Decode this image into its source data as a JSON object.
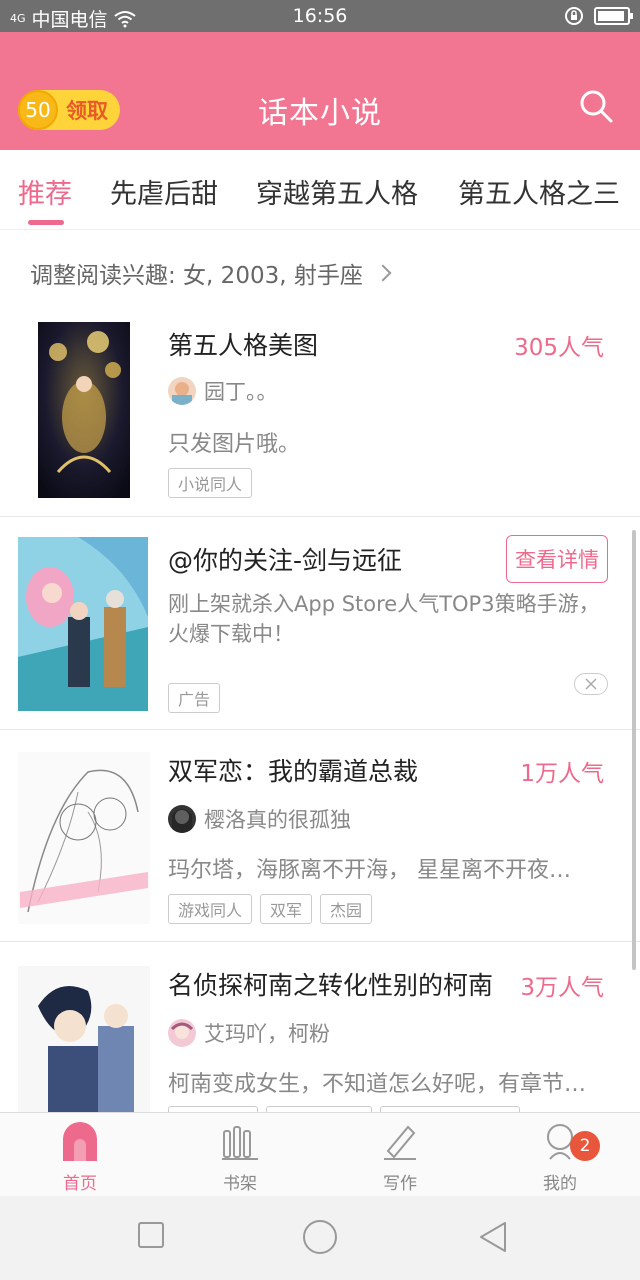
{
  "status_bar": {
    "signal": "4G",
    "carrier": "中国电信",
    "time": "16:56"
  },
  "header": {
    "coin_value": "50",
    "coin_label": "领取",
    "title": "话本小说",
    "accent": "#f27592"
  },
  "tabs": [
    {
      "label": "推荐",
      "active": true
    },
    {
      "label": "先虐后甜"
    },
    {
      "label": "穿越第五人格"
    },
    {
      "label": "第五人格之三"
    }
  ],
  "interest": {
    "label": "调整阅读兴趣: 女, 2003, 射手座"
  },
  "items": [
    {
      "title": "第五人格美图",
      "popularity": "305人气",
      "author": "园丁。。",
      "desc": "只发图片哦。",
      "tags": [
        "小说同人"
      ]
    },
    {
      "title": "@你的关注-剑与远征",
      "action": "查看详情",
      "desc": "刚上架就杀入App Store人气TOP3策略手游，火爆下载中！",
      "tags": [
        "广告"
      ]
    },
    {
      "title": "双军恋：我的霸道总裁",
      "popularity": "1万人气",
      "author": "樱洛真的很孤独",
      "desc": "玛尔塔，海豚离不开海， 星星离不开夜…",
      "tags": [
        "游戏同人",
        "双军",
        "杰园"
      ]
    },
    {
      "title": "名侦探柯南之转化性别的柯南",
      "popularity": "3万人气",
      "author": "艾玛吖，柯粉",
      "desc": "柯南变成女生，不知道怎么好呢，有章节…"
    }
  ],
  "bottom_nav": [
    {
      "label": "首页",
      "icon": "home-icon",
      "active": true
    },
    {
      "label": "书架",
      "icon": "bookshelf-icon"
    },
    {
      "label": "写作",
      "icon": "pen-icon"
    },
    {
      "label": "我的",
      "icon": "profile-icon",
      "badge": "2"
    }
  ]
}
